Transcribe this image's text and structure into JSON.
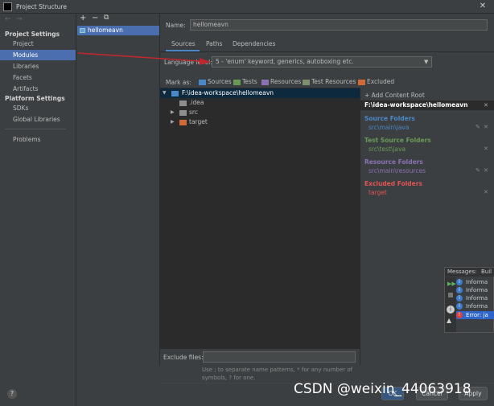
{
  "window": {
    "title": "Project Structure",
    "close_glyph": "✕"
  },
  "nav": {
    "back_glyph": "←",
    "forward_glyph": "→",
    "project_settings_header": "Project Settings",
    "project_settings_items": [
      "Project",
      "Modules",
      "Libraries",
      "Facets",
      "Artifacts"
    ],
    "selected_item": "Modules",
    "platform_settings_header": "Platform Settings",
    "platform_settings_items": [
      "SDKs",
      "Global Libraries"
    ],
    "problems": "Problems",
    "help_glyph": "?"
  },
  "modules": {
    "add_glyph": "+",
    "remove_glyph": "−",
    "copy_glyph": "⧉",
    "items": [
      "hellomeavn"
    ]
  },
  "module": {
    "name_label": "Name:",
    "name_value": "hellomeavn",
    "tabs": [
      "Sources",
      "Paths",
      "Dependencies"
    ],
    "active_tab": "Sources",
    "language_level_label": "Language level:",
    "language_level_value": "5 - 'enum' keyword, generics, autoboxing etc.",
    "mark_as_label": "Mark as:",
    "mark_as": [
      "Sources",
      "Tests",
      "Resources",
      "Test Resources",
      "Excluded"
    ],
    "tree": {
      "root": "F:\\idea-workspace\\hellomeavn",
      "children": [
        ".idea",
        "src",
        "target"
      ]
    },
    "exclude_files_label": "Exclude files:",
    "exclude_files_value": "",
    "exclude_hint": "Use ; to separate name patterns, * for any number of symbols, ? for one."
  },
  "roots_panel": {
    "add_content_root": "+ Add Content Root",
    "root_path": "F:\\idea-workspace\\hellomeavn",
    "source_folders_label": "Source Folders",
    "source_folders": [
      "src\\main\\java"
    ],
    "test_source_folders_label": "Test Source Folders",
    "test_source_folders": [
      "src\\test\\java"
    ],
    "resource_folders_label": "Resource Folders",
    "resource_folders": [
      "src\\main\\resources"
    ],
    "excluded_folders_label": "Excluded Folders",
    "excluded_folders": [
      "target"
    ],
    "edit_glyph": "✎",
    "remove_glyph": "✕"
  },
  "messages": {
    "tabs": [
      "Messages:",
      "Buil"
    ],
    "rows": [
      "Informa",
      "Informa",
      "Informa",
      "Informa",
      "Error: ja"
    ],
    "info_glyph": "i",
    "error_glyph": "!"
  },
  "buttons": {
    "ok": "OK",
    "cancel": "Cancel",
    "apply": "Apply"
  },
  "watermark": "CSDN @weixin_44063918",
  "colors": {
    "selection": "#4b6eaf",
    "source": "#4a88c7",
    "test": "#6a9955",
    "resource": "#8a72b5",
    "excluded": "#d06b38",
    "annotation_arrow": "#c0272d"
  }
}
